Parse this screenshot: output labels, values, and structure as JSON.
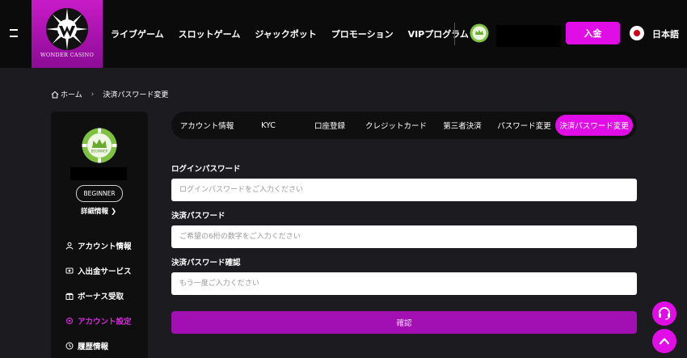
{
  "header": {
    "logo_text": "WONDER CASINO",
    "nav": [
      "ライブゲーム",
      "スロットゲーム",
      "ジャックポット",
      "プロモーション",
      "VIPプログラム"
    ],
    "deposit_label": "入金",
    "language": "日本語"
  },
  "breadcrumb": {
    "home": "ホーム",
    "current": "決済パスワード変更"
  },
  "sidebar": {
    "badge_text": "BEGINNER",
    "level": "BEGINNER",
    "detail_link": "詳細情報",
    "menu": [
      {
        "label": "アカウント情報",
        "icon": "user-icon",
        "active": false
      },
      {
        "label": "入出金サービス",
        "icon": "transfer-icon",
        "active": false
      },
      {
        "label": "ボーナス受取",
        "icon": "gift-icon",
        "active": false
      },
      {
        "label": "アカウント設定",
        "icon": "settings-icon",
        "active": true
      },
      {
        "label": "履歴情報",
        "icon": "history-icon",
        "active": false
      }
    ]
  },
  "tabs": [
    {
      "label": "アカウント情報",
      "active": false
    },
    {
      "label": "KYC",
      "active": false
    },
    {
      "label": "口座登録",
      "active": false
    },
    {
      "label": "クレジットカード",
      "active": false
    },
    {
      "label": "第三者決済",
      "active": false
    },
    {
      "label": "パスワード変更",
      "active": false
    },
    {
      "label": "決済パスワード変更",
      "active": true
    }
  ],
  "form": {
    "login_password": {
      "label": "ログインパスワード",
      "placeholder": "ログインパスワードをご入力ください",
      "value": ""
    },
    "payment_password": {
      "label": "決済パスワード",
      "placeholder": "ご希望の6桁の数字をご入力ください",
      "value": ""
    },
    "payment_password_confirm": {
      "label": "決済パスワード確認",
      "placeholder": "もう一度ご入力ください",
      "value": ""
    },
    "submit_label": "確認"
  },
  "colors": {
    "accent": "#e10de6",
    "button": "#a20fb3",
    "active_menu": "#d42ad8",
    "background": "#1c1b1f",
    "header": "#0b0b0c"
  }
}
